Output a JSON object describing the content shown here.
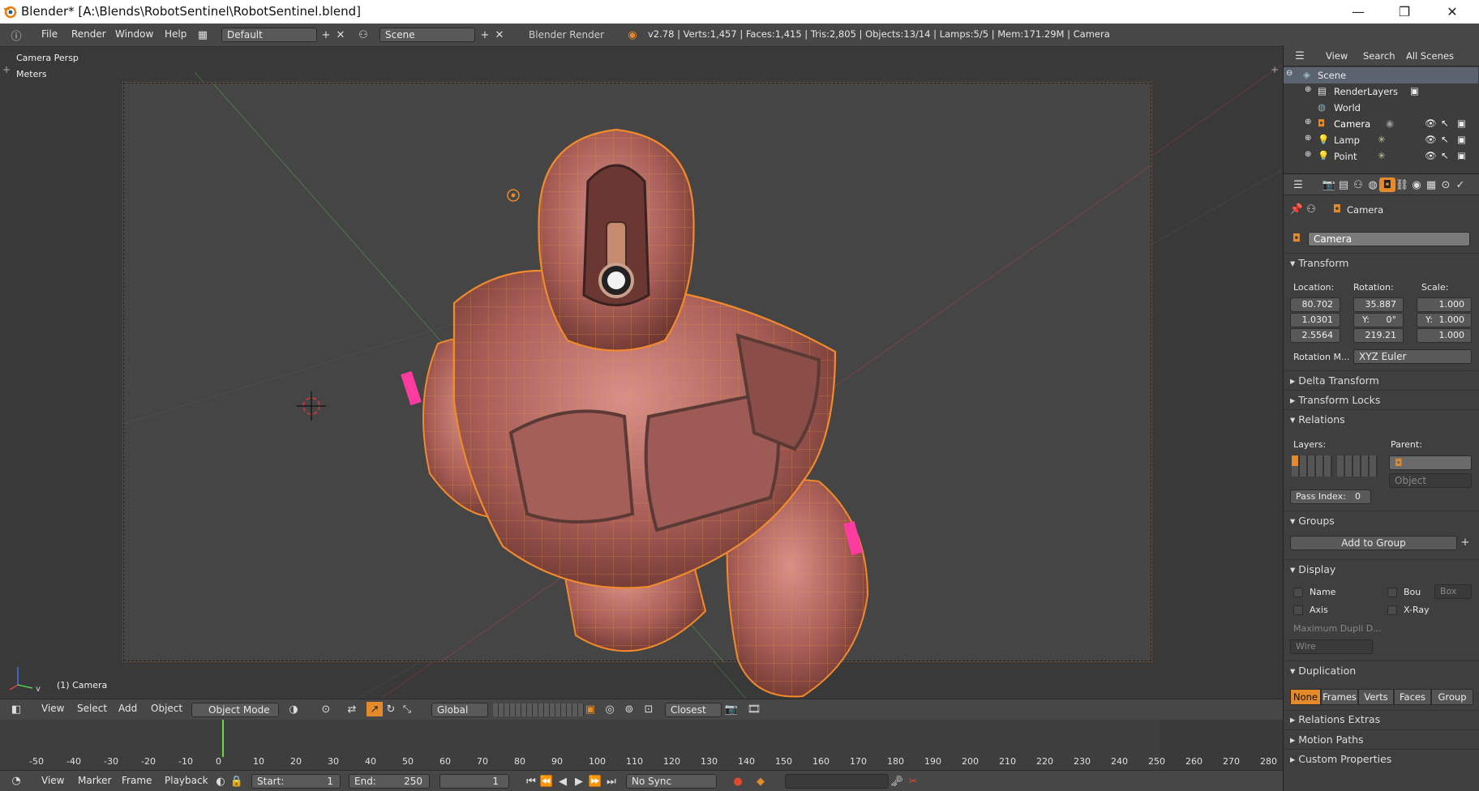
{
  "window": {
    "title": "Blender* [A:\\Blends\\RobotSentinel\\RobotSentinel.blend]",
    "minimize": "—",
    "maximize": "❐",
    "close": "✕"
  },
  "infobar": {
    "menus": [
      "File",
      "Render",
      "Window",
      "Help"
    ],
    "layout": "Default",
    "scene": "Scene",
    "engine": "Blender Render",
    "stats": "v2.78 | Verts:1,457 | Faces:1,415 | Tris:2,805 | Objects:13/14 | Lamps:5/5 | Mem:171.29M | Camera"
  },
  "viewport": {
    "view_name": "Camera Persp",
    "units": "Meters",
    "object_label": "(1) Camera"
  },
  "view3d_header": {
    "menus": [
      "View",
      "Select",
      "Add",
      "Object"
    ],
    "mode": "Object Mode",
    "orientation": "Global",
    "snap": "Closest"
  },
  "timeline": {
    "ticks": [
      "-50",
      "-40",
      "-30",
      "-20",
      "-10",
      "0",
      "10",
      "20",
      "30",
      "40",
      "50",
      "60",
      "70",
      "80",
      "90",
      "100",
      "110",
      "120",
      "130",
      "140",
      "150",
      "160",
      "170",
      "180",
      "190",
      "200",
      "210",
      "220",
      "230",
      "240",
      "250",
      "260",
      "270",
      "280"
    ],
    "current_frame_marker": 1,
    "menus": [
      "View",
      "Marker",
      "Frame",
      "Playback"
    ],
    "start_label": "Start:",
    "start_value": "1",
    "end_label": "End:",
    "end_value": "250",
    "current": "1",
    "sync": "No Sync"
  },
  "outliner": {
    "menus": [
      "View",
      "Search",
      "All Scenes"
    ],
    "items": [
      {
        "label": "Scene"
      },
      {
        "label": "RenderLayers"
      },
      {
        "label": "World"
      },
      {
        "label": "Camera"
      },
      {
        "label": "Lamp"
      },
      {
        "label": "Point"
      }
    ]
  },
  "properties": {
    "breadcrumb": "Camera",
    "object_name": "Camera",
    "transform": {
      "header": "Transform",
      "location_label": "Location:",
      "rotation_label": "Rotation:",
      "scale_label": "Scale:",
      "location": [
        "80.702",
        "1.0301",
        "2.5564"
      ],
      "rotation": [
        "35.887",
        "0°",
        "219.21"
      ],
      "rotation_y_prefix": "Y:",
      "scale": [
        "1.000",
        "1.000",
        "1.000"
      ],
      "scale_y_prefix": "Y:",
      "rotation_mode_label": "Rotation M...",
      "rotation_mode": "XYZ Euler"
    },
    "collapsed_panels": [
      "Delta Transform",
      "Transform Locks"
    ],
    "relations": {
      "header": "Relations",
      "layers_label": "Layers:",
      "parent_label": "Parent:",
      "parent_type_placeholder": "Object",
      "pass_index_label": "Pass Index:",
      "pass_index": "0"
    },
    "groups": {
      "header": "Groups",
      "add_button": "Add to Group"
    },
    "display": {
      "header": "Display",
      "name": "Name",
      "bounds": "Bou",
      "bounds_type": "Box",
      "axis": "Axis",
      "xray": "X-Ray",
      "max_dupli": "Maximum Dupli D...",
      "max_dupli_value": "Wire"
    },
    "duplication": {
      "header": "Duplication",
      "options": [
        "None",
        "Frames",
        "Verts",
        "Faces",
        "Group"
      ],
      "active": "None"
    },
    "bottom_panels": [
      "Relations Extras",
      "Motion Paths",
      "Custom Properties"
    ]
  },
  "colors": {
    "accent": "#e48a2b",
    "selected_object": "#f08a2c",
    "robot_body": "#b46a63",
    "background": "#393939"
  }
}
